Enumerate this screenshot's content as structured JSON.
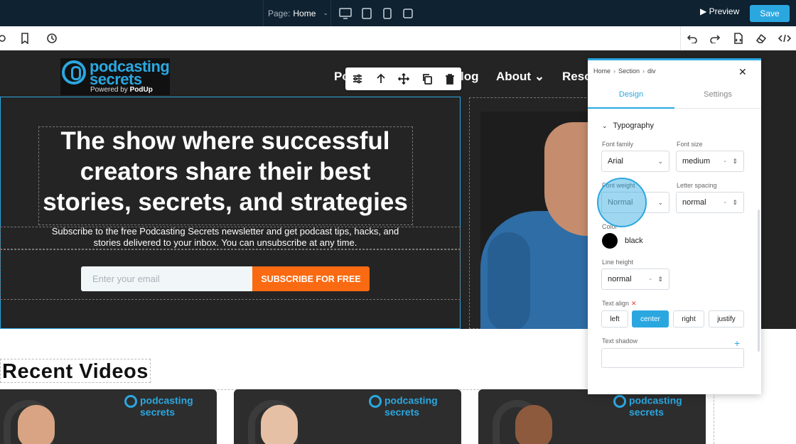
{
  "topbar": {
    "page_label": "Page:",
    "page_value": "Home",
    "preview_label": "▶ Preview",
    "save_label": "Save"
  },
  "site": {
    "logo_line1": "podcasting",
    "logo_line2": "secrets",
    "logo_powered": "Powered by",
    "logo_brand": "PodUp",
    "nav": [
      "Po",
      "log",
      "About ⌄",
      "Reso"
    ],
    "hero_title": "The show where successful creators share their best stories, secrets, and strategies",
    "hero_subtitle": "Subscribe to the free Podcasting Secrets newsletter and get podcast tips, hacks, and stories delivered to your inbox. You can unsubscribe at any time.",
    "email_placeholder": "Enter your email",
    "subscribe_label": "SUBSCRIBE FOR FREE",
    "section_title": "Recent Videos",
    "thumb_logo1": "podcasting",
    "thumb_logo2": "secrets"
  },
  "panel": {
    "breadcrumb": [
      "Home",
      "Section",
      "div"
    ],
    "tab_design": "Design",
    "tab_settings": "Settings",
    "section": "Typography",
    "font_family_label": "Font family",
    "font_family_value": "Arial",
    "font_size_label": "Font size",
    "font_size_value": "medium",
    "font_weight_label": "Font weight",
    "font_weight_value": "Normal",
    "letter_spacing_label": "Letter spacing",
    "letter_spacing_value": "normal",
    "color_label": "Color",
    "color_value": "black",
    "line_height_label": "Line height",
    "line_height_value": "normal",
    "text_align_label": "Text align",
    "align_options": [
      "left",
      "center",
      "right",
      "justify"
    ],
    "text_shadow_label": "Text shadow"
  },
  "colors": {
    "accent": "#2ba7e0",
    "topbar": "#0f2231",
    "hero_bg": "#242424",
    "cta": "#fa6a12"
  }
}
